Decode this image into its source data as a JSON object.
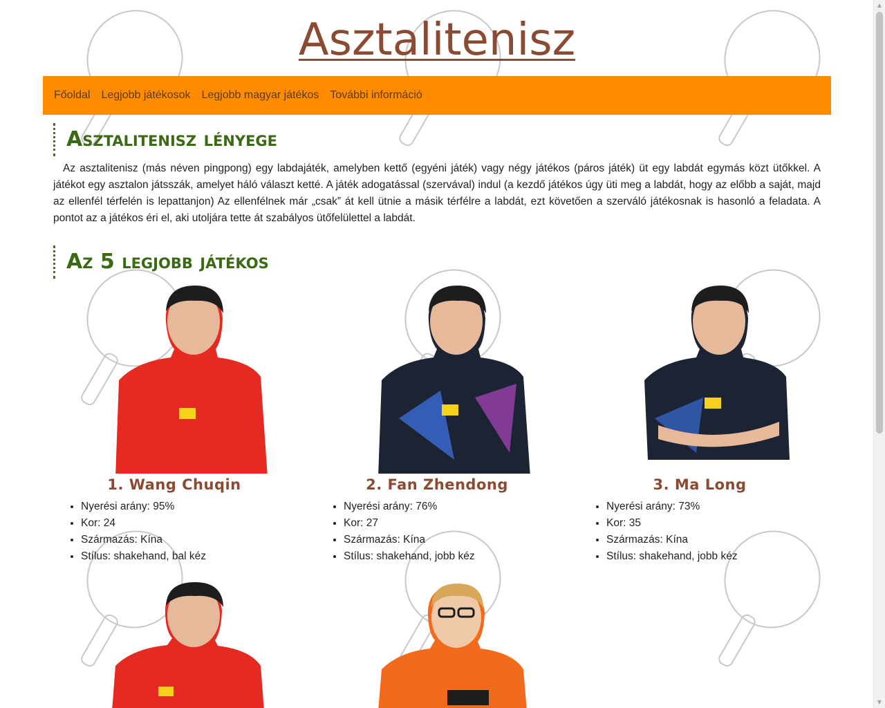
{
  "site": {
    "title": "Asztalitenisz"
  },
  "nav": {
    "items": [
      "Főoldal",
      "Legjobb játékosok",
      "Legjobb magyar játékos",
      "További információ"
    ]
  },
  "sections": {
    "essence": {
      "title": "Asztalitenisz lényege",
      "text": "Az asztalitenisz (más néven pingpong) egy labdajáték, amelyben kettő (egyéni játék) vagy négy játékos (páros játék) üt egy labdát egymás közt ütőkkel. A játékot egy asztalon játsszák, amelyet háló választ ketté. A játék adogatással (szervával) indul (a kezdő játékos úgy üti meg a labdát, hogy az előbb a saját, majd az ellenfél térfelén is lepattanjon) Az ellenfélnek már „csak” át kell ütnie a másik térfélre a labdát, ezt követően a szerváló játékosnak is hasonló a feladata. A pontot az a játékos éri el, aki utoljára tette át szabályos ütőfelülettel a labdát."
    },
    "top5": {
      "title": "Az 5 legjobb játékos"
    }
  },
  "players": [
    {
      "name": "1. Wang Chuqin",
      "stats": [
        "Nyerési arány: 95%",
        "Kor: 24",
        "Származás: Kína",
        "Stílus: shakehand, bal kéz"
      ],
      "jersey": "#e52a22"
    },
    {
      "name": "2. Fan Zhendong",
      "stats": [
        "Nyerési arány: 76%",
        "Kor: 27",
        "Származás: Kína",
        "Stílus: shakehand, jobb kéz"
      ],
      "jersey": "#1c2333"
    },
    {
      "name": "3. Ma Long",
      "stats": [
        "Nyerési arány: 73%",
        "Kor: 35",
        "Származás: Kína",
        "Stílus: shakehand, jobb kéz"
      ],
      "jersey": "#1c2333"
    },
    {
      "jersey": "#e52a22"
    },
    {
      "jersey": "#f26b1d"
    }
  ],
  "colors": {
    "nav_bg": "#ff8c00",
    "title": "#8b4a32",
    "section_title": "#3b6a14"
  }
}
